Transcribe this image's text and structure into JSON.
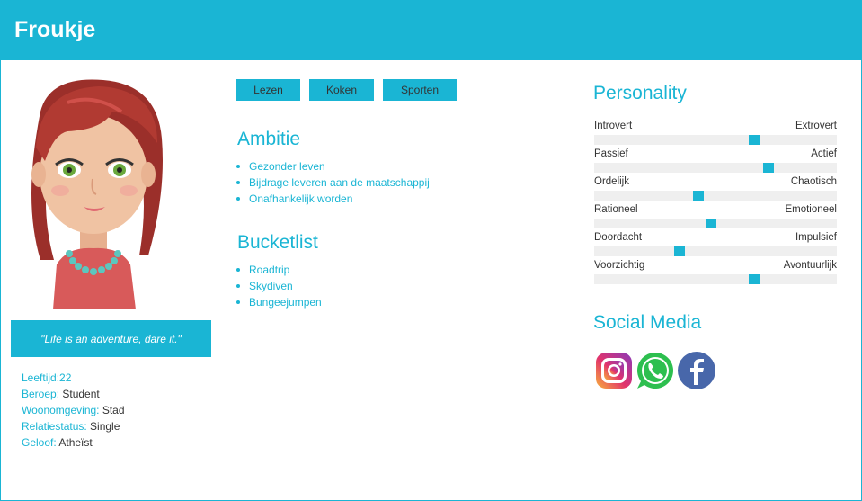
{
  "header": {
    "name": "Froukje"
  },
  "quote": "\"Life is an adventure, dare it.\"",
  "facts": [
    {
      "key": "Leeftijd:",
      "value": "22"
    },
    {
      "key": "Beroep:",
      "value": " Student"
    },
    {
      "key": "Woonomgeving:",
      "value": " Stad"
    },
    {
      "key": "Relatiestatus:",
      "value": " Single"
    },
    {
      "key": "Geloof:",
      "value": " Atheïst"
    }
  ],
  "tags": [
    "Lezen",
    "Koken",
    "Sporten"
  ],
  "ambitie": {
    "title": "Ambitie",
    "items": [
      "Gezonder leven",
      "Bijdrage leveren aan de maatschappij",
      "Onafhankelijk worden"
    ]
  },
  "bucketlist": {
    "title": "Bucketlist",
    "items": [
      "Roadtrip",
      "Skydiven",
      "Bungeejumpen"
    ]
  },
  "personality": {
    "title": "Personality",
    "traits": [
      {
        "left": "Introvert",
        "right": "Extrovert",
        "level": 0.66
      },
      {
        "left": "Passief",
        "right": "Actief",
        "level": 0.72
      },
      {
        "left": "Ordelijk",
        "right": "Chaotisch",
        "level": 0.43
      },
      {
        "left": "Rationeel",
        "right": "Emotioneel",
        "level": 0.48
      },
      {
        "left": "Doordacht",
        "right": "Impulsief",
        "level": 0.35
      },
      {
        "left": "Voorzichtig",
        "right": "Avontuurlijk",
        "level": 0.66
      }
    ]
  },
  "social": {
    "title": "Social Media",
    "icons": [
      "instagram-icon",
      "whatsapp-icon",
      "facebook-icon"
    ]
  },
  "colors": {
    "accent": "#1ab5d4",
    "track": "#efefef"
  }
}
